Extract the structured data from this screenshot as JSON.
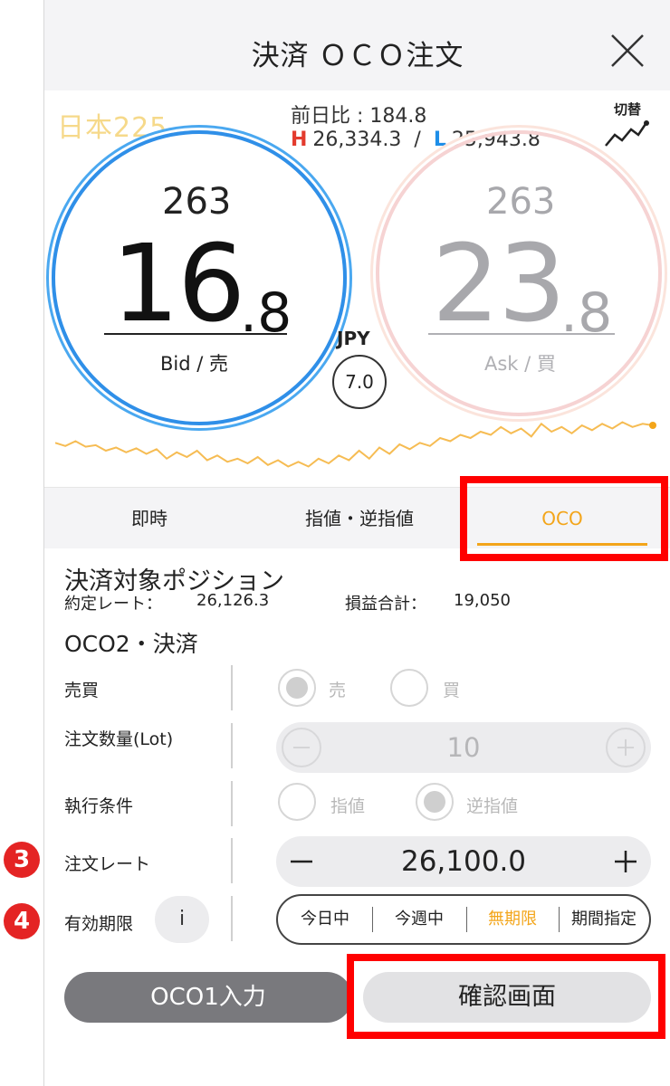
{
  "header": {
    "title": "決済 ＯＣＯ注文"
  },
  "instrument": {
    "symbol": "日本225",
    "prev_day_label": "前日比 : ",
    "prev_day_value": "184.8",
    "high_letter": "H",
    "high_value": "26,334.3",
    "separator": "/",
    "low_letter": "L",
    "low_value": "25,943.8",
    "switch_label": "切替"
  },
  "bid": {
    "top": "263",
    "big": "16",
    "small": ".8",
    "label": "Bid / 売"
  },
  "ask": {
    "top": "263",
    "big": "23",
    "small": ".8",
    "label": "Ask / 買"
  },
  "spread": {
    "currency": "JPY",
    "value": "7.0"
  },
  "tabs": {
    "now": "即時",
    "limit": "指値・逆指値",
    "oco": "OCO"
  },
  "position": {
    "title": "決済対象ポジション",
    "rate_label": "約定レート：",
    "rate_value": "26,126.3",
    "pl_label": "損益合計：",
    "pl_value": "19,050"
  },
  "section_title": "OCO2・決済",
  "form": {
    "side_label": "売買",
    "side_sell": "売",
    "side_buy": "買",
    "qty_label": "注文数量(Lot)",
    "qty_value": "10",
    "exec_label": "執行条件",
    "exec_limit": "指値",
    "exec_stop": "逆指値",
    "rate_label": "注文レート",
    "rate_value": "26,100.0",
    "expiry_label": "有効期限",
    "info_label": "i",
    "expiry_options": [
      "今日中",
      "今週中",
      "無期限",
      "期間指定"
    ],
    "expiry_selected": "無期限"
  },
  "badges": {
    "step3": "3",
    "step4": "4"
  },
  "buttons": {
    "oco1": "OCO1入力",
    "confirm": "確認画面"
  },
  "colors": {
    "accent": "#f3a51a",
    "highlight": "#ff0000",
    "bid": "#2f8fe8",
    "high": "#e33b2e",
    "low": "#1e8ee8",
    "badge": "#e42424"
  },
  "sparkline": {
    "series": [
      50,
      46,
      52,
      45,
      47,
      40,
      44,
      38,
      43,
      36,
      42,
      30,
      38,
      32,
      40,
      28,
      34,
      26,
      30,
      24,
      32,
      22,
      28,
      20,
      26,
      20,
      30,
      24,
      34,
      28,
      40,
      30,
      44,
      36,
      48,
      42,
      50,
      46,
      56,
      52,
      60,
      56,
      64,
      60,
      70,
      62,
      68,
      58,
      74,
      64,
      70,
      62,
      72,
      66,
      74,
      68,
      76,
      70,
      74,
      72
    ]
  }
}
